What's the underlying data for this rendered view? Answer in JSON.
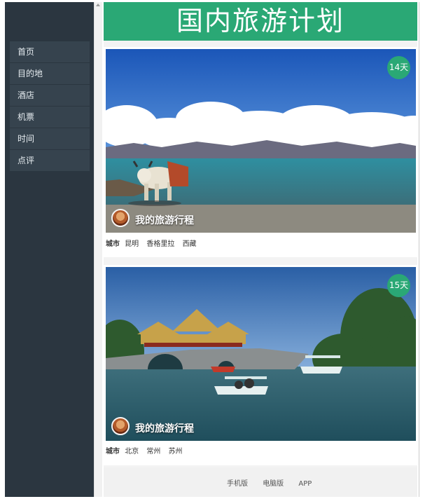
{
  "sidebar": {
    "items": [
      {
        "label": "首页"
      },
      {
        "label": "目的地"
      },
      {
        "label": "酒店"
      },
      {
        "label": "机票"
      },
      {
        "label": "时间"
      },
      {
        "label": "点评"
      }
    ]
  },
  "header": {
    "title": "国内旅游计划"
  },
  "trips": [
    {
      "badge": "14天",
      "title": "我的旅游行程",
      "city_label": "城市",
      "cities": [
        "昆明",
        "香格里拉",
        "西藏"
      ]
    },
    {
      "badge": "15天",
      "title": "我的旅游行程",
      "city_label": "城市",
      "cities": [
        "北京",
        "常州",
        "苏州"
      ]
    }
  ],
  "footer": {
    "links": [
      "手机版",
      "电脑版",
      "APP"
    ]
  },
  "colors": {
    "accent": "#2aa875",
    "sidebar": "#2b3640"
  }
}
